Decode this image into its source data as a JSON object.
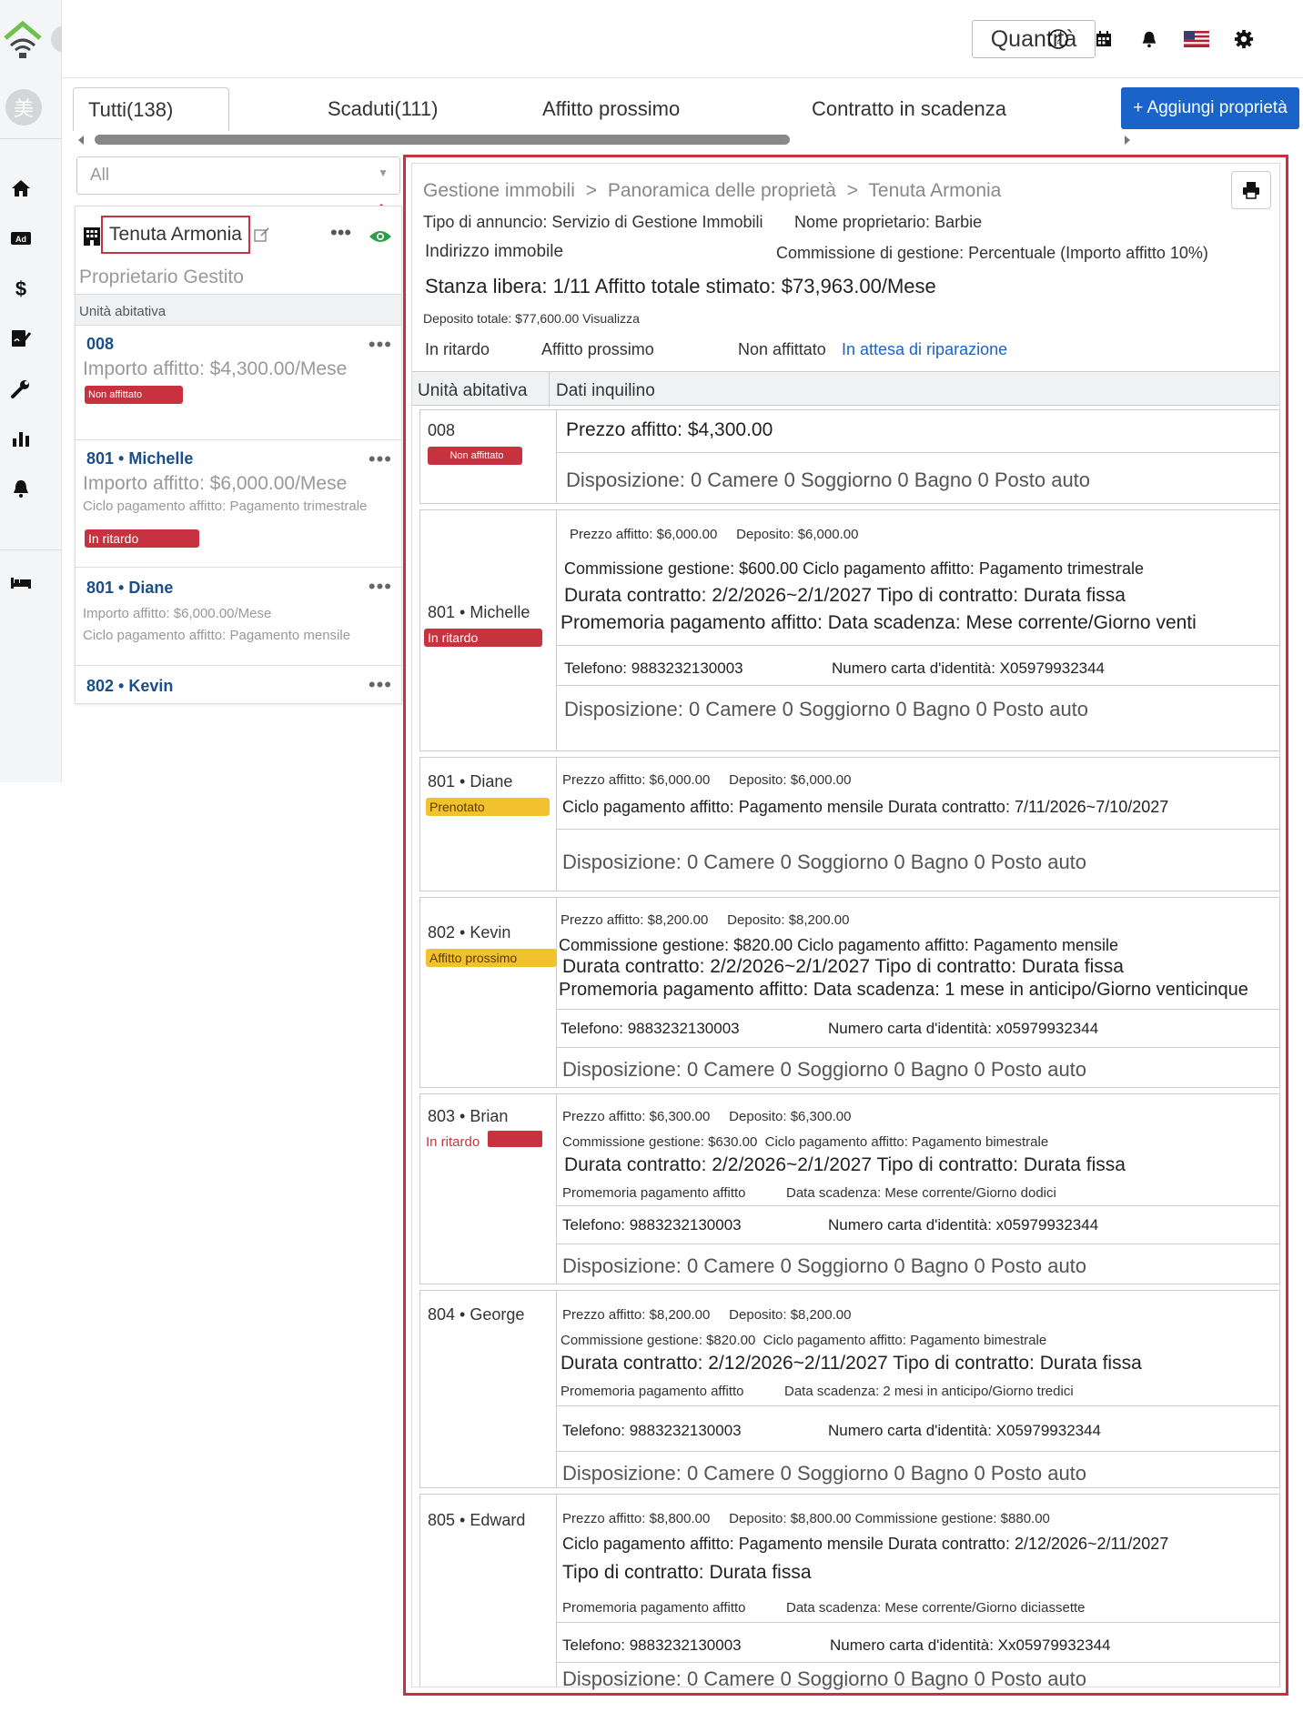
{
  "sidebar": {
    "avatar_char": "美",
    "items": [
      "home-icon",
      "ad-icon",
      "dollar-icon",
      "sign-icon",
      "wrench-icon",
      "chart-icon",
      "bell-icon",
      "bed-icon"
    ]
  },
  "topbar": {
    "quantity_label": "Quantità"
  },
  "tabs": [
    {
      "label": "Tutti(138)"
    },
    {
      "label": "Scaduti(111)"
    },
    {
      "label": "Affitto prossimo"
    },
    {
      "label": "Contratto in scadenza"
    }
  ],
  "add_button": "+ Aggiungi proprietà",
  "filter": {
    "value": "All"
  },
  "property_card": {
    "name": "Tenuta Armonia",
    "owner_type": "Proprietario Gestito",
    "section_label": "Unità abitativa",
    "units": [
      {
        "title": "008",
        "rent": "Importo affitto: $4,300.00/Mese",
        "cycle": "",
        "status": "Non affittato"
      },
      {
        "title": "801 • Michelle",
        "rent": "Importo affitto: $6,000.00/Mese",
        "cycle": "Ciclo pagamento affitto: Pagamento trimestrale",
        "status": "In ritardo"
      },
      {
        "title": "801 • Diane",
        "rent": "Importo affitto: $6,000.00/Mese",
        "cycle": "Ciclo pagamento affitto: Pagamento mensile",
        "status": ""
      },
      {
        "title": "802 • Kevin",
        "rent": "",
        "cycle": "",
        "status": ""
      }
    ]
  },
  "detail": {
    "breadcrumb": [
      "Gestione immobili",
      ">",
      "Panoramica delle proprietà",
      ">",
      "Tenuta Armonia"
    ],
    "listing_type": "Tipo di annuncio: Servizio di Gestione Immobili",
    "owner_name": "Nome proprietario: Barbie",
    "address": "Indirizzo immobile",
    "commission": "Commissione di gestione: Percentuale (Importo affitto 10%)",
    "vacancy": "Stanza libera: 1/11 Affitto totale stimato: $73,963.00/Mese",
    "deposit": "Deposito totale: $77,600.00 Visualizza",
    "filters": [
      "In ritardo",
      "Affitto prossimo",
      "Non affittato",
      "In attesa di riparazione"
    ],
    "table_headers": [
      "Unità abitativa",
      "Dati inquilino"
    ],
    "layout_text": "Disposizione: 0 Camere 0 Soggiorno 0 Bagno 0 Posto auto",
    "units": [
      {
        "name": "008",
        "status": "Non affittato",
        "l1": "Prezzo affitto: $4,300.00"
      },
      {
        "name": "801 • Michelle",
        "status": "In ritardo",
        "l1": "Prezzo affitto: $6,000.00     Deposito: $6,000.00",
        "l2": "Commissione gestione: $600.00 Ciclo pagamento affitto: Pagamento trimestrale",
        "l3": "Durata contratto: 2/2/2026~2/1/2027 Tipo di contratto: Durata fissa",
        "l4": "Promemoria pagamento affitto: Data scadenza: Mese corrente/Giorno venti",
        "phone": "Telefono: 9883232130003",
        "id": "Numero carta d'identità: X05979932344"
      },
      {
        "name": "801 • Diane",
        "status": "Prenotato",
        "l1": "Prezzo affitto: $6,000.00     Deposito: $6,000.00",
        "l2": "Ciclo pagamento affitto: Pagamento mensile Durata contratto: 7/11/2026~7/10/2027"
      },
      {
        "name": "802 • Kevin",
        "status": "Affitto prossimo",
        "l1": "Prezzo affitto: $8,200.00     Deposito: $8,200.00",
        "l2": "Commissione gestione: $820.00 Ciclo pagamento affitto: Pagamento mensile",
        "l3": "Durata contratto: 2/2/2026~2/1/2027 Tipo di contratto: Durata fissa",
        "l4": "Promemoria pagamento affitto: Data scadenza: 1 mese in anticipo/Giorno venticinque",
        "phone": "Telefono: 9883232130003",
        "id": "Numero carta d'identità: x05979932344"
      },
      {
        "name": "803 • Brian",
        "status": "In ritardo",
        "l1": "Prezzo affitto: $6,300.00     Deposito: $6,300.00",
        "l2": "Commissione gestione: $630.00  Ciclo pagamento affitto: Pagamento bimestrale",
        "l3": "Durata contratto: 2/2/2026~2/1/2027 Tipo di contratto: Durata fissa",
        "l4a": "Promemoria pagamento affitto",
        "l4b": "Data scadenza: Mese corrente/Giorno dodici",
        "phone": "Telefono: 9883232130003",
        "id": "Numero carta d'identità: x05979932344"
      },
      {
        "name": "804 • George",
        "status": "",
        "l1": "Prezzo affitto: $8,200.00     Deposito: $8,200.00",
        "l2": "Commissione gestione: $820.00  Ciclo pagamento affitto: Pagamento bimestrale",
        "l3": "Durata contratto: 2/12/2026~2/11/2027 Tipo di contratto: Durata fissa",
        "l4a": "Promemoria pagamento affitto",
        "l4b": "Data scadenza: 2 mesi in anticipo/Giorno tredici",
        "phone": "Telefono: 9883232130003",
        "id": "Numero carta d'identità: X05979932344"
      },
      {
        "name": "805 • Edward",
        "status": "",
        "l1": "Prezzo affitto: $8,800.00     Deposito: $8,800.00 Commissione gestione: $880.00",
        "l2": "Ciclo pagamento affitto: Pagamento mensile Durata contratto: 2/12/2026~2/11/2027",
        "l3": "Tipo di contratto: Durata fissa",
        "l4a": "Promemoria pagamento affitto",
        "l4b": "Data scadenza: Mese corrente/Giorno diciassette",
        "phone": "Telefono: 9883232130003",
        "id": "Numero carta d'identità: Xx05979932344"
      }
    ]
  },
  "colors": {
    "accent": "#1a63c9",
    "danger": "#c8323e",
    "warning": "#f2c12e",
    "link": "#1a4f8a",
    "brand_green": "#6cc24a"
  }
}
